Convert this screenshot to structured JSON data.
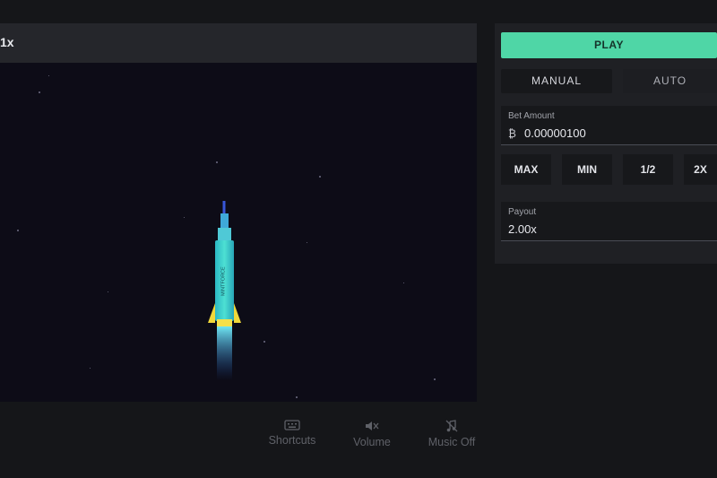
{
  "game": {
    "multiplier": "1x",
    "rocket_brand": "MINTFORCE"
  },
  "footer": {
    "shortcuts_label": "Shortcuts",
    "volume_label": "Volume",
    "music_label": "Music Off"
  },
  "panel": {
    "play_label": "PLAY",
    "mode_manual": "MANUAL",
    "mode_auto": "AUTO",
    "bet_amount_label": "Bet Amount",
    "bet_amount_value": "0.00000100",
    "quick_buttons": [
      "MAX",
      "MIN",
      "1/2",
      "2X"
    ],
    "payout_label": "Payout",
    "payout_value": "2.00x"
  },
  "colors": {
    "accent": "#4fd6a6",
    "canvas_bg": "#0d0c17",
    "panel_bg": "#1f2024",
    "rocket_body": "#3fd3c8",
    "rocket_fins": "#f0d83a"
  },
  "icons": {
    "keyboard": "keyboard-icon",
    "volume": "volume-muted-icon",
    "music": "music-off-icon",
    "bitcoin": "bitcoin-icon"
  }
}
